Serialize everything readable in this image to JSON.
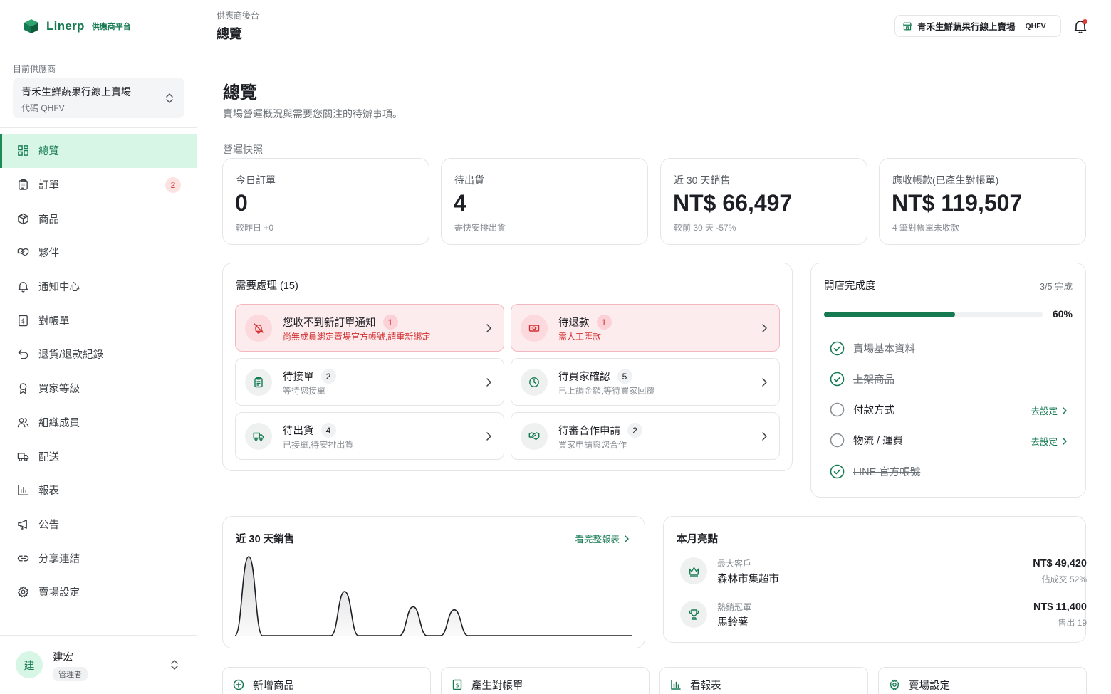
{
  "brand": {
    "name": "Linerp",
    "sub": "供應商平台"
  },
  "sidebar": {
    "supplier_label": "目前供應商",
    "supplier_name": "青禾生鮮蔬果行線上賣場",
    "supplier_code": "代碼 QHFV",
    "items": [
      {
        "label": "總覽",
        "icon": "dashboard-icon",
        "active": true
      },
      {
        "label": "訂單",
        "icon": "clipboard-icon",
        "badge": "2"
      },
      {
        "label": "商品",
        "icon": "box-icon"
      },
      {
        "label": "夥伴",
        "icon": "handshake-icon"
      },
      {
        "label": "通知中心",
        "icon": "bell-icon"
      },
      {
        "label": "對帳單",
        "icon": "invoice-icon"
      },
      {
        "label": "退貨/退款紀錄",
        "icon": "return-icon"
      },
      {
        "label": "買家等級",
        "icon": "award-icon"
      },
      {
        "label": "組織成員",
        "icon": "users-icon"
      },
      {
        "label": "配送",
        "icon": "truck-icon"
      },
      {
        "label": "報表",
        "icon": "bar-chart-icon"
      },
      {
        "label": "公告",
        "icon": "megaphone-icon"
      },
      {
        "label": "分享連結",
        "icon": "link-icon"
      },
      {
        "label": "賣場設定",
        "icon": "gear-icon"
      }
    ],
    "user": {
      "avatar": "建",
      "name": "建宏",
      "role": "管理者"
    }
  },
  "header": {
    "breadcrumb": "供應商後台",
    "title": "總覽",
    "store_name": "青禾生鮮蔬果行線上賣場",
    "store_code": "QHFV"
  },
  "main": {
    "title": "總覽",
    "subtitle": "賣場營運概況與需要您關注的待辦事項。",
    "snapshot_label": "營運快照",
    "kpis": [
      {
        "label": "今日訂單",
        "value": "0",
        "note": "較昨日 +0"
      },
      {
        "label": "待出貨",
        "value": "4",
        "note": "盡快安排出貨"
      },
      {
        "label": "近 30 天銷售",
        "value": "NT$ 66,497",
        "note": "較前 30 天 -57%"
      },
      {
        "label": "應收帳款(已產生對帳單)",
        "value": "NT$ 119,507",
        "note": "4 筆對帳單未收款"
      }
    ],
    "todo": {
      "title": "需要處理 (15)",
      "items": [
        {
          "title": "您收不到新訂單通知",
          "count": "1",
          "desc": "尚無成員綁定賣場官方帳號,請重新綁定",
          "icon": "bell-off-icon",
          "alert": true
        },
        {
          "title": "待退款",
          "count": "1",
          "desc": "需人工匯款",
          "icon": "cash-icon",
          "alert": true
        },
        {
          "title": "待接單",
          "count": "2",
          "desc": "等待您接單",
          "icon": "clipboard-icon",
          "alert": false
        },
        {
          "title": "待買家確認",
          "count": "5",
          "desc": "已上調金額,等待買家回覆",
          "icon": "clock-icon",
          "alert": false
        },
        {
          "title": "待出貨",
          "count": "4",
          "desc": "已接單,待安排出貨",
          "icon": "truck-icon",
          "alert": false
        },
        {
          "title": "待審合作申請",
          "count": "2",
          "desc": "買家申請與您合作",
          "icon": "handshake-icon",
          "alert": false
        }
      ]
    },
    "setup": {
      "title": "開店完成度",
      "count": "3/5 完成",
      "percent": "60%",
      "progress": 0.6,
      "steps": [
        {
          "label": "賣場基本資料",
          "done": true
        },
        {
          "label": "上架商品",
          "done": true
        },
        {
          "label": "付款方式",
          "done": false,
          "action": "去設定"
        },
        {
          "label": "物流 / 運費",
          "done": false,
          "action": "去設定"
        },
        {
          "label": "LINE 官方帳號",
          "done": true
        }
      ]
    },
    "sales": {
      "title": "近 30 天銷售",
      "link": "看完整報表"
    },
    "highlights": {
      "title": "本月亮點",
      "items": [
        {
          "label": "最大客戶",
          "name": "森林市集超市",
          "value": "NT$ 49,420",
          "sub": "佔成交 52%",
          "icon": "crown-icon"
        },
        {
          "label": "熱銷冠軍",
          "name": "馬鈴薯",
          "value": "NT$ 11,400",
          "sub": "售出 19",
          "icon": "trophy-icon"
        }
      ]
    },
    "quick_actions": [
      {
        "label": "新增商品",
        "icon": "plus-circle-icon"
      },
      {
        "label": "產生對帳單",
        "icon": "invoice-icon"
      },
      {
        "label": "看報表",
        "icon": "bar-chart-icon"
      },
      {
        "label": "賣場設定",
        "icon": "gear-icon"
      }
    ]
  },
  "chart_data": {
    "type": "area",
    "title": "近 30 天銷售",
    "x_count": 30,
    "values": [
      0,
      52000,
      0,
      0,
      0,
      0,
      0,
      0,
      29000,
      0,
      0,
      0,
      0,
      19000,
      0,
      0,
      17000,
      0,
      0,
      0,
      0,
      0,
      0,
      0,
      0,
      0,
      0,
      0,
      0,
      0
    ],
    "grid": false,
    "axes_visible": false
  },
  "colors": {
    "accent": "#157a52",
    "accent_light": "#d7f6e6",
    "alert": "#d32f2f",
    "alert_bg": "#fdecee"
  }
}
